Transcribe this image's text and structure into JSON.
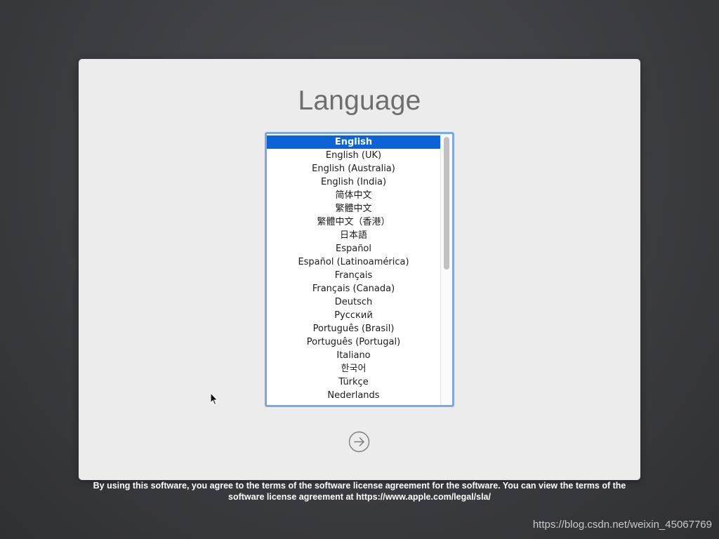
{
  "title": "Language",
  "languages": [
    "English",
    "English (UK)",
    "English (Australia)",
    "English (India)",
    "简体中文",
    "繁體中文",
    "繁體中文（香港）",
    "日本語",
    "Español",
    "Español (Latinoamérica)",
    "Français",
    "Français (Canada)",
    "Deutsch",
    "Русский",
    "Português (Brasil)",
    "Português (Portugal)",
    "Italiano",
    "한국어",
    "Türkçe",
    "Nederlands"
  ],
  "selected_index": 0,
  "next_button_icon": "arrow-right-circle-icon",
  "license_text": "By using this software, you agree to the terms of the software license agreement for the software. You can view the terms of the software license agreement at https://www.apple.com/legal/sla/",
  "watermark": "https://blog.csdn.net/weixin_45067769",
  "colors": {
    "selection": "#0b63d6",
    "focus_ring": "#79a7e8",
    "panel": "#ececec",
    "title": "#6e6e6e"
  }
}
